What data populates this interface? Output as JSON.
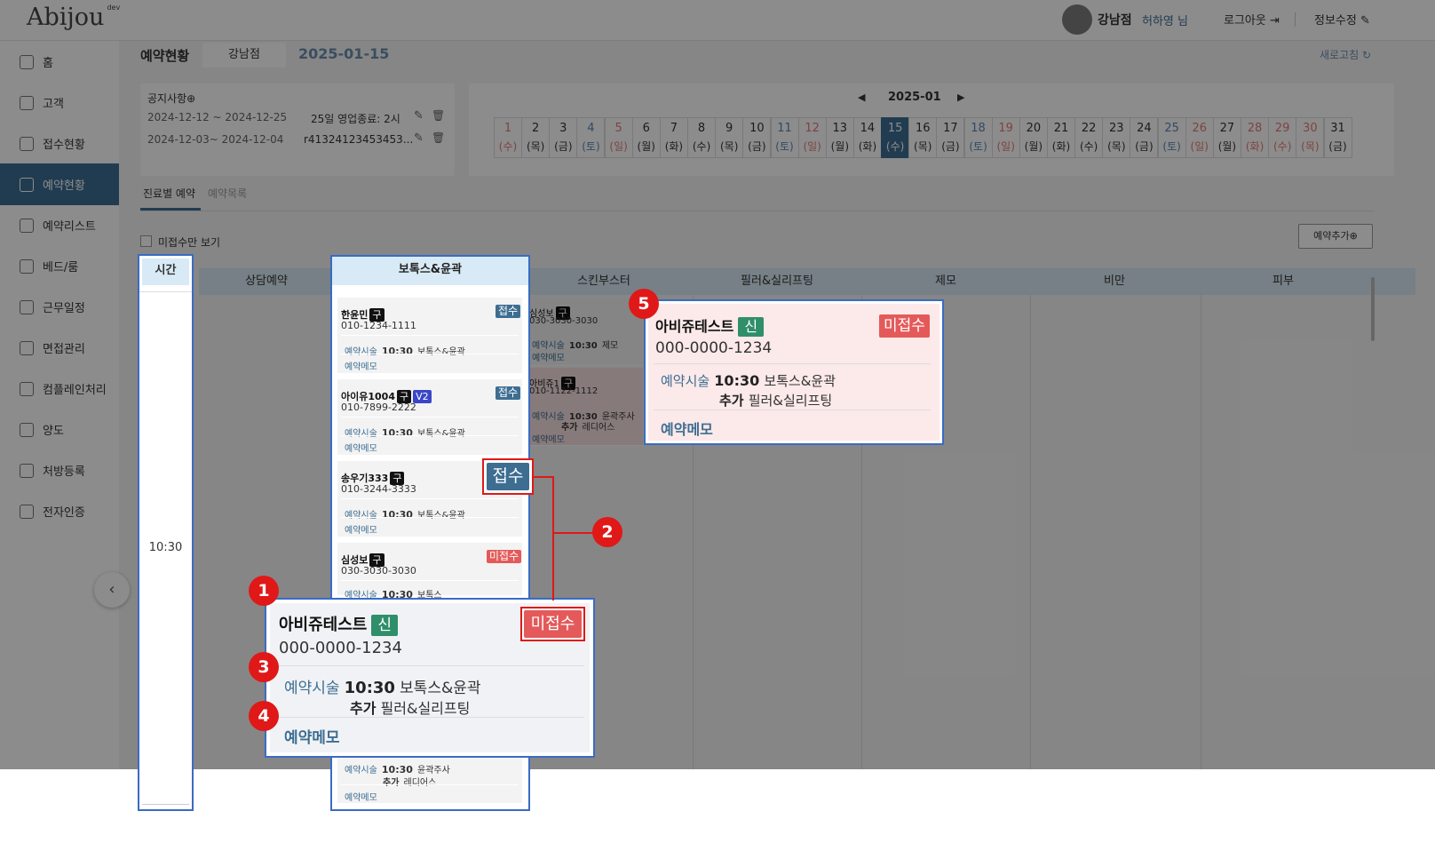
{
  "header": {
    "logo": "Abijou",
    "logo_tag": "dev",
    "branch": "강남점",
    "user": "허하영 님",
    "logout": "로그아웃",
    "profile": "정보수정"
  },
  "sidebar": {
    "items": [
      {
        "label": "홈",
        "icon": "home-icon"
      },
      {
        "label": "고객",
        "icon": "people-icon"
      },
      {
        "label": "접수현황",
        "icon": "reception-icon"
      },
      {
        "label": "예약현황",
        "icon": "calendar-icon",
        "active": true
      },
      {
        "label": "예약리스트",
        "icon": "list-icon"
      },
      {
        "label": "베드/룸",
        "icon": "bed-icon"
      },
      {
        "label": "근무일정",
        "icon": "schedule-icon"
      },
      {
        "label": "면접관리",
        "icon": "interview-icon"
      },
      {
        "label": "컴플레인처리",
        "icon": "complaint-icon"
      },
      {
        "label": "양도",
        "icon": "transfer-icon"
      },
      {
        "label": "처방등록",
        "icon": "prescription-icon"
      },
      {
        "label": "전자인증",
        "icon": "certificate-icon"
      }
    ]
  },
  "page": {
    "title": "예약현황",
    "branch_tab": "강남점",
    "date": "2025-01-15",
    "refresh": "새로고침"
  },
  "notice": {
    "title": "공지사항",
    "rows": [
      {
        "period": "2024-12-12 ~ 2024-12-25",
        "text": "25일 영업종료: 2시"
      },
      {
        "period": "2024-12-03~ 2024-12-04",
        "text": "r41324123453453..."
      }
    ]
  },
  "calendar": {
    "month": "2025-01",
    "days": [
      {
        "d": "1",
        "w": "(수)",
        "c": "holiday"
      },
      {
        "d": "2",
        "w": "(목)",
        "c": "normal"
      },
      {
        "d": "3",
        "w": "(금)",
        "c": "normal"
      },
      {
        "d": "4",
        "w": "(토)",
        "c": "sat"
      },
      {
        "d": "5",
        "w": "(일)",
        "c": "holiday"
      },
      {
        "d": "6",
        "w": "(월)",
        "c": "normal"
      },
      {
        "d": "7",
        "w": "(화)",
        "c": "normal"
      },
      {
        "d": "8",
        "w": "(수)",
        "c": "normal"
      },
      {
        "d": "9",
        "w": "(목)",
        "c": "normal"
      },
      {
        "d": "10",
        "w": "(금)",
        "c": "normal"
      },
      {
        "d": "11",
        "w": "(토)",
        "c": "sat"
      },
      {
        "d": "12",
        "w": "(일)",
        "c": "holiday"
      },
      {
        "d": "13",
        "w": "(월)",
        "c": "normal"
      },
      {
        "d": "14",
        "w": "(화)",
        "c": "normal"
      },
      {
        "d": "15",
        "w": "(수)",
        "c": "selected"
      },
      {
        "d": "16",
        "w": "(목)",
        "c": "normal"
      },
      {
        "d": "17",
        "w": "(금)",
        "c": "normal"
      },
      {
        "d": "18",
        "w": "(토)",
        "c": "sat"
      },
      {
        "d": "19",
        "w": "(일)",
        "c": "holiday"
      },
      {
        "d": "20",
        "w": "(월)",
        "c": "normal"
      },
      {
        "d": "21",
        "w": "(화)",
        "c": "normal"
      },
      {
        "d": "22",
        "w": "(수)",
        "c": "normal"
      },
      {
        "d": "23",
        "w": "(목)",
        "c": "normal"
      },
      {
        "d": "24",
        "w": "(금)",
        "c": "normal"
      },
      {
        "d": "25",
        "w": "(토)",
        "c": "sat"
      },
      {
        "d": "26",
        "w": "(일)",
        "c": "holiday"
      },
      {
        "d": "27",
        "w": "(월)",
        "c": "normal"
      },
      {
        "d": "28",
        "w": "(화)",
        "c": "holiday"
      },
      {
        "d": "29",
        "w": "(수)",
        "c": "holiday"
      },
      {
        "d": "30",
        "w": "(목)",
        "c": "holiday"
      },
      {
        "d": "31",
        "w": "(금)",
        "c": "normal"
      }
    ]
  },
  "tabs": {
    "by_treatment": "진료별 예약",
    "list": "예약목록"
  },
  "filter": {
    "unreceived_only": "미접수만 보기"
  },
  "add_button": "예약추가",
  "columns": {
    "time": "시간",
    "consult": "상담예약",
    "botox": "보톡스&윤곽",
    "skinbooster": "스킨부스터",
    "filler": "필러&실리프팅",
    "hair": "제모",
    "obesity": "비만",
    "skin": "피부"
  },
  "time_slot": "10:30",
  "labels": {
    "reserve": "예약시술",
    "memo": "예약메모",
    "add": "추가",
    "received": "접수",
    "not_received": "미접수"
  },
  "botox_cards": [
    {
      "name": "한윤민",
      "tags": [
        "구"
      ],
      "phone": "010-1234-1111",
      "status": "접수",
      "time": "10:30",
      "treat": "보톡스&윤곽"
    },
    {
      "name": "아이유1004",
      "tags": [
        "구",
        "V2"
      ],
      "phone": "010-7899-2222",
      "status": "접수",
      "time": "10:30",
      "treat": "보톡스&윤곽"
    },
    {
      "name": "송우기333",
      "tags": [
        "구"
      ],
      "phone": "010-3244-3333",
      "status": "접수",
      "time": "10:30",
      "treat": "보톡스&윤곽"
    },
    {
      "name": "심성보",
      "tags": [
        "구"
      ],
      "phone": "030-3030-3030",
      "status": "미접수",
      "time": "10:30",
      "treat": "보톡스"
    }
  ],
  "bottom_card": {
    "time": "10:30",
    "treat": "윤곽주사",
    "add": "레디어스"
  },
  "skin_cards": [
    {
      "name": "심성보",
      "tag": "구",
      "phone": "030-3030-3030",
      "time": "10:30",
      "treat": "제모"
    },
    {
      "name": "아비쥬1",
      "tag": "구",
      "phone": "010-1122-1112",
      "time": "10:30",
      "treat": "윤곽주사",
      "add": "레디어스"
    }
  ],
  "zoom_card": {
    "name": "아비쥬테스트",
    "tag": "신",
    "phone": "000-0000-1234",
    "status": "미접수",
    "time": "10:30",
    "treat": "보톡스&윤곽",
    "add": "필러&실리프팅"
  },
  "markers": [
    "1",
    "2",
    "3",
    "4",
    "5"
  ],
  "colors": {
    "primary": "#3d6e92",
    "danger": "#e45a5a",
    "new_tag": "#2f8f6b",
    "highlight": "#3a6bc4",
    "marker": "#e01818"
  }
}
